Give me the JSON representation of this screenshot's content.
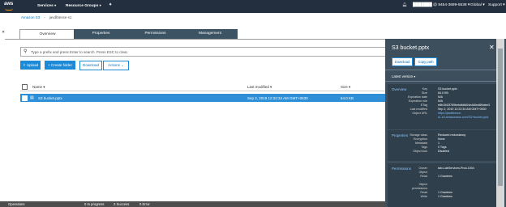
{
  "topnav": {
    "logo": "aws",
    "services": "Services",
    "resource_groups": "Resource Groups",
    "account": "███████ @ 8454-3699-5538",
    "region": "Global",
    "support": "Support"
  },
  "breadcrumb": {
    "root": "Amazon S3",
    "bucket": "javdbtesse-s1"
  },
  "tabs": [
    "Overview",
    "Properties",
    "Permissions",
    "Management"
  ],
  "search": {
    "placeholder": "Type a prefix and press Enter to search. Press ESC to clear."
  },
  "toolbar": {
    "upload": "Upload",
    "create_folder": "+ Create folder",
    "download": "Download",
    "actions": "Actions ⌄"
  },
  "table": {
    "headers": {
      "name": "Name ▾",
      "last_modified": "Last modified ▾",
      "size": "Size ▾"
    },
    "rows": [
      {
        "name": "S3 bucket.pptx",
        "last_modified": "Sep 2, 2019 12:22:34 AM GMT+0530",
        "size": "64.0 KB"
      }
    ]
  },
  "status": {
    "operations": "Operations",
    "in_progress": "0 In progress",
    "success": "2 Success",
    "error": "0 Error"
  },
  "panel": {
    "title": "S3 bucket.pptx",
    "download": "Download",
    "copy_path": "Copy path",
    "latest_version": "Latest version ▾",
    "overview": {
      "label": "Overview",
      "rows": [
        {
          "k": "Key",
          "v": "S3 bucket.pptx"
        },
        {
          "k": "Size",
          "v": "64.0 KB"
        },
        {
          "k": "Expiration date",
          "v": "N/A"
        },
        {
          "k": "Expiration rule",
          "v": "N/A"
        },
        {
          "k": "ETag",
          "v": "e8b1542f769bebdb8d04e4d0ed8f4abe3"
        },
        {
          "k": "Last modified",
          "v": "Sep 2, 2019 12:22:34 AM GMT+0530"
        },
        {
          "k": "Object URL",
          "v": "https://javdbtesse-"
        },
        {
          "k": "",
          "v": "s1.s3.amazonaws.com/S3+bucket.pptx"
        }
      ]
    },
    "properties": {
      "label": "Properties",
      "rows": [
        {
          "k": "Storage class",
          "v": "Reduced redundancy"
        },
        {
          "k": "Encryption",
          "v": "None"
        },
        {
          "k": "Metadata",
          "v": "1"
        },
        {
          "k": "Tags",
          "v": "0 Tags"
        },
        {
          "k": "Object lock",
          "v": "Disabled"
        }
      ]
    },
    "permissions": {
      "label": "Permissions",
      "rows": [
        {
          "k": "Owner",
          "v": "tatv-LabServices-Prod-1504"
        },
        {
          "k": "Object",
          "v": ""
        },
        {
          "k": "Read",
          "v": "1 Grantees"
        },
        {
          "k": "",
          "v": ""
        },
        {
          "k": "Object",
          "v": ""
        },
        {
          "k": "permissions",
          "v": ""
        },
        {
          "k": "Read",
          "v": "1 Grantees"
        },
        {
          "k": "Write",
          "v": "1 Grantees"
        }
      ]
    }
  },
  "colors": {
    "nav": "#232f3e",
    "accent": "#1c8ad7",
    "panel": "#3d4f5d",
    "tab": "#3b5363",
    "orange": "#ff9900"
  }
}
